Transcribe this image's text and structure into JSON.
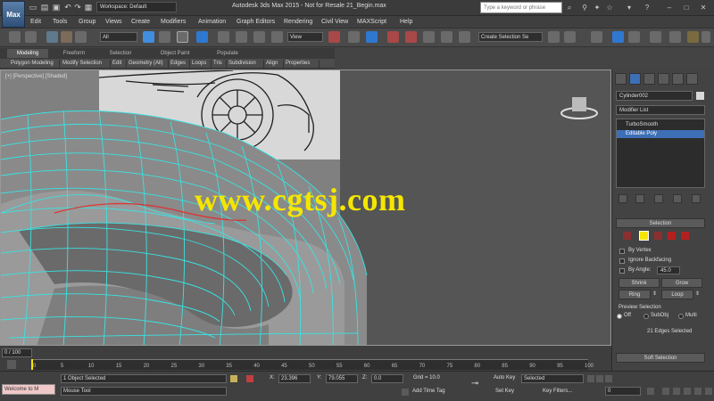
{
  "title_bar": {
    "app_button": "Max",
    "workspace": "Workspace: Default",
    "window_title": "Autodesk 3ds Max 2015 - Not for Resale   21_Begin.max",
    "search_placeholder": "Type a keyword or phrase"
  },
  "menu": {
    "items": [
      "Edit",
      "Tools",
      "Group",
      "Views",
      "Create",
      "Modifiers",
      "Animation",
      "Graph Editors",
      "Rendering",
      "Civil View",
      "MAXScript",
      "Help"
    ]
  },
  "toolbar": {
    "selection_filter": "All",
    "view_dropdown": "View",
    "named_selection": "Create Selection Se"
  },
  "ribbon": {
    "tabs": [
      "Modeling",
      "Freeform",
      "Selection",
      "Object Paint",
      "Populate"
    ],
    "buttons": [
      "Polygon Modeling",
      "Modify Selection",
      "Edit",
      "Geometry (All)",
      "Edges",
      "Loops",
      "Tris",
      "Subdivision",
      "Align",
      "Properties"
    ]
  },
  "viewport": {
    "label": "[+] [Perspective] [Shaded]",
    "watermark": "www.cgtsj.com"
  },
  "command_panel": {
    "object_name": "Cylinder002",
    "modifier_list": "Modifier List",
    "stack": [
      "TurboSmooth",
      "Editable Poly"
    ],
    "selection_header": "Selection",
    "by_vertex": "By Vertex",
    "ignore_backfacing": "Ignore Backfacing",
    "by_angle": "By Angle:",
    "by_angle_value": "45.0",
    "shrink": "Shrink",
    "grow": "Grow",
    "ring": "Ring",
    "loop": "Loop",
    "preview_selection": "Preview Selection",
    "preview_off": "Off",
    "preview_subobj": "SubObj",
    "preview_multi": "Multi",
    "selection_status": "21 Edges Selected",
    "soft_selection": "Soft Selection"
  },
  "timeline": {
    "frame_indicator": "0 / 100",
    "ticks": [
      "0",
      "5",
      "10",
      "15",
      "20",
      "25",
      "30",
      "35",
      "40",
      "45",
      "50",
      "55",
      "60",
      "65",
      "70",
      "75",
      "80",
      "85",
      "90",
      "95",
      "100"
    ]
  },
  "status_bar": {
    "listener_label": "Welcome to M",
    "selection_info": "1 Object Selected",
    "prompt": "Mouse Tool",
    "x_label": "X:",
    "x_value": "23.396",
    "y_label": "Y:",
    "y_value": "79.055",
    "z_label": "Z:",
    "z_value": "0.0",
    "grid": "Grid = 10.0",
    "add_time_tag": "Add Time Tag",
    "auto_key": "Auto Key",
    "auto_key_value": "Selected",
    "set_key": "Set Key",
    "key_filters": "Key Filters...",
    "frame_value": "0"
  },
  "colors": {
    "wire": "#39e3e3",
    "watermark": "#f5e600",
    "selected_stack": "#3d6fb6"
  }
}
